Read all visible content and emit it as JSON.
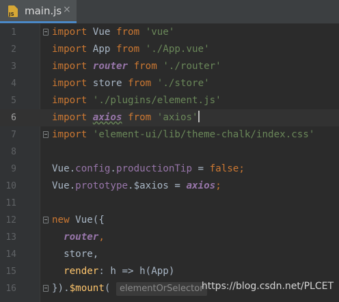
{
  "tab": {
    "title": "main.js",
    "icon_label": "JS",
    "close": "×"
  },
  "lines": [
    {
      "n": "1"
    },
    {
      "n": "2"
    },
    {
      "n": "3"
    },
    {
      "n": "4"
    },
    {
      "n": "5"
    },
    {
      "n": "6"
    },
    {
      "n": "7"
    },
    {
      "n": "8"
    },
    {
      "n": "9"
    },
    {
      "n": "10"
    },
    {
      "n": "11"
    },
    {
      "n": "12"
    },
    {
      "n": "13"
    },
    {
      "n": "14"
    },
    {
      "n": "15"
    },
    {
      "n": "16"
    }
  ],
  "tokens": {
    "import": "import",
    "from": "from",
    "vue_id": "Vue",
    "vue_str": "'vue'",
    "app_id": "App",
    "app_str": "'./App.vue'",
    "router_id": "router",
    "router_str": "'./router'",
    "store_id": "store",
    "store_str": "'./store'",
    "plugins_str": "'./plugins/element.js'",
    "axios_id": "axios",
    "axios_str": "'axios'",
    "elementui_str": "'element-ui/lib/theme-chalk/index.css'",
    "config_prefix": "Vue.",
    "config": "config",
    "dot": ".",
    "productionTip": "productionTip",
    "assign_false": " = ",
    "false_kw": "false",
    "semi": ";",
    "prototype": "prototype",
    "axios_prop": ".$axios = ",
    "new_kw": "new",
    "new_vue": " Vue({",
    "router_prop": "router",
    "comma": ",",
    "store_line": "store,",
    "render": "render",
    "render_rest": ": h => h(App)",
    "close_prefix": "}).",
    "mount": "$mount",
    "paren": "(",
    "hint": "elementOrSelector"
  },
  "watermark": "https://blog.csdn.net/PLCET"
}
